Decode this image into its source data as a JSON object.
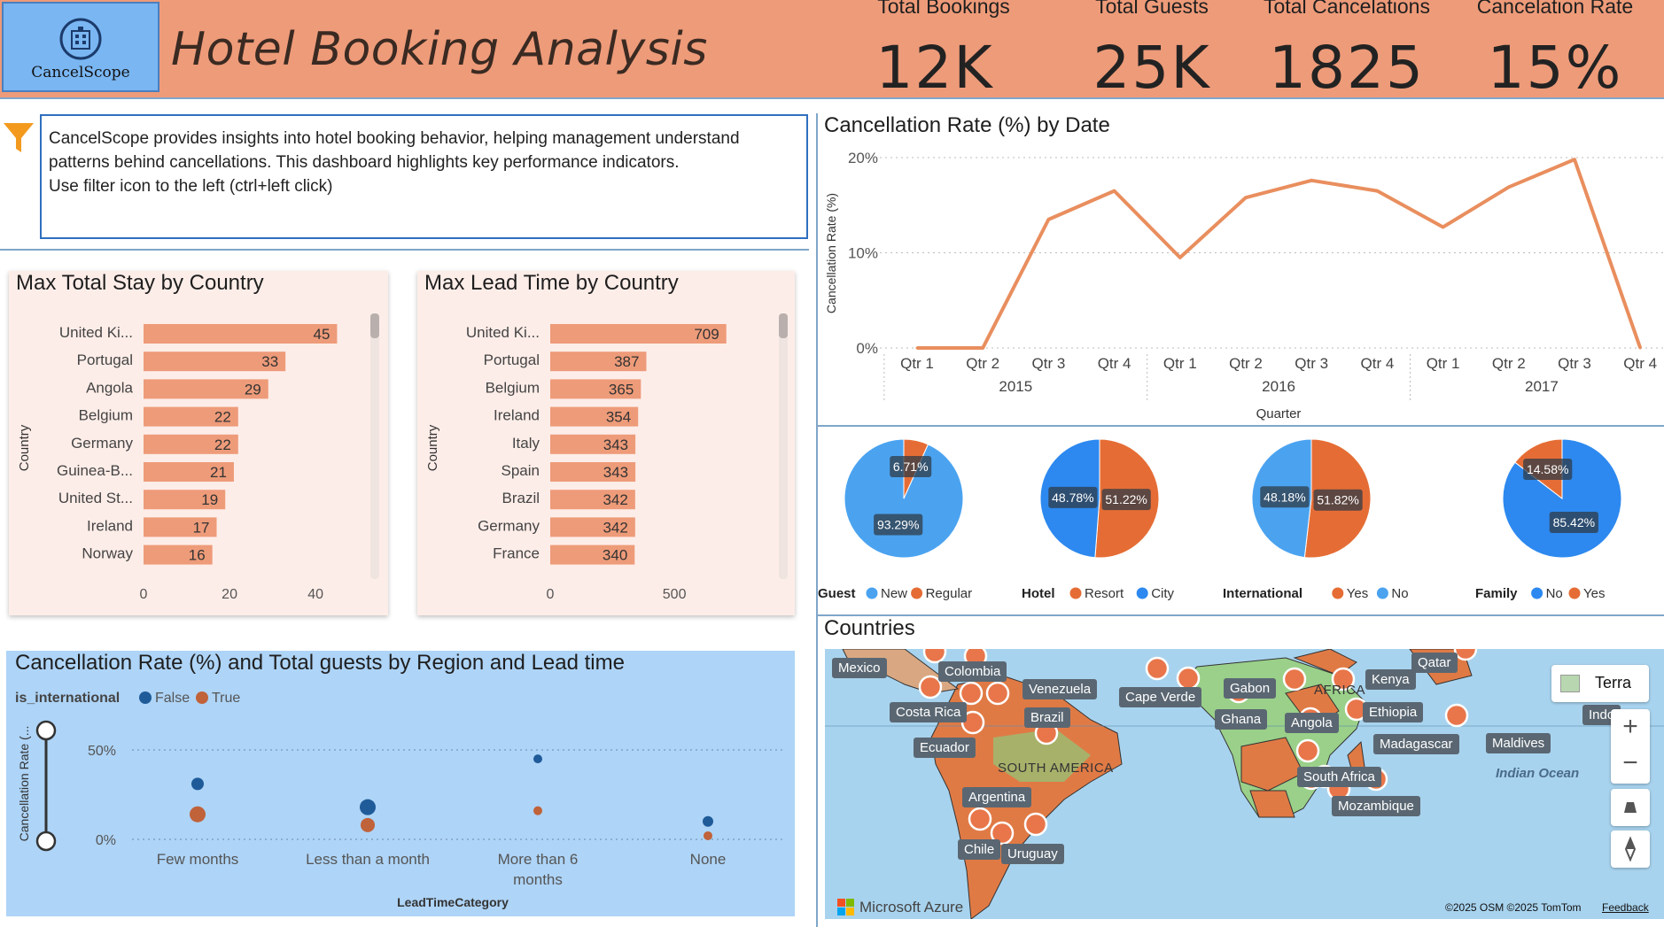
{
  "header": {
    "logo_text": "CancelScope",
    "title": "Hotel Booking Analysis",
    "kpis": [
      {
        "label": "Total Bookings",
        "value": "12K"
      },
      {
        "label": "Total Guests",
        "value": "25K"
      },
      {
        "label": "Total Cancelations",
        "value": "1825"
      },
      {
        "label": "Cancelation Rate",
        "value": "15%"
      }
    ]
  },
  "description": {
    "line1": "CancelScope provides insights into hotel booking behavior, helping management understand",
    "line2": "patterns behind cancellations. This dashboard highlights key performance indicators.",
    "line3": "Use filter icon to the left (ctrl+left click)"
  },
  "colors": {
    "header_bg": "#EE9B79",
    "bar": "#EE9B79",
    "orange": "#E56D35",
    "blue": "#2D89EF",
    "light_blue": "#4BA3F0",
    "panel_bg": "#FDEDE8",
    "scatter_bg": "#AED4F7",
    "navy": "#1F5B99"
  },
  "chart_data": [
    {
      "type": "bar",
      "title": "Max Total Stay by Country",
      "ylabel": "Country",
      "categories": [
        "United Ki...",
        "Portugal",
        "Angola",
        "Belgium",
        "Germany",
        "Guinea-B...",
        "United St...",
        "Ireland",
        "Norway"
      ],
      "values": [
        45,
        33,
        29,
        22,
        22,
        21,
        19,
        17,
        16
      ],
      "xticks": [
        "0",
        "20",
        "40"
      ],
      "xlim": [
        0,
        48
      ]
    },
    {
      "type": "bar",
      "title": "Max Lead Time by Country",
      "ylabel": "Country",
      "categories": [
        "United Ki...",
        "Portugal",
        "Belgium",
        "Ireland",
        "Italy",
        "Spain",
        "Brazil",
        "Germany",
        "France"
      ],
      "values": [
        709,
        387,
        365,
        354,
        343,
        343,
        342,
        342,
        340
      ],
      "xticks": [
        "0",
        "500"
      ],
      "xlim": [
        0,
        760
      ]
    },
    {
      "type": "line",
      "title": "Cancellation Rate (%) by Date",
      "xlabel": "Quarter",
      "ylabel": "Cancellation Rate (%)",
      "x": [
        "Qtr 1",
        "Qtr 2",
        "Qtr 3",
        "Qtr 4",
        "Qtr 1",
        "Qtr 2",
        "Qtr 3",
        "Qtr 4",
        "Qtr 1",
        "Qtr 2",
        "Qtr 3",
        "Qtr 4"
      ],
      "years": [
        "2015",
        "2016",
        "2017"
      ],
      "values": [
        0,
        0,
        13.5,
        16.5,
        9.5,
        15.8,
        17.6,
        16.5,
        12.7,
        16.9,
        19.8,
        0
      ],
      "yticks": [
        "0%",
        "10%",
        "20%"
      ],
      "ylim": [
        0,
        20
      ]
    },
    {
      "type": "pie",
      "legend_title": "Guest",
      "labels": [
        "New",
        "Regular"
      ],
      "values": [
        93.29,
        6.71
      ],
      "value_labels": [
        "93.29%",
        "6.71%"
      ]
    },
    {
      "type": "pie",
      "legend_title": "Hotel",
      "labels": [
        "Resort",
        "City"
      ],
      "values": [
        51.22,
        48.78
      ],
      "value_labels": [
        "51.22%",
        "48.78%"
      ]
    },
    {
      "type": "pie",
      "legend_title": "International",
      "labels": [
        "Yes",
        "No"
      ],
      "values": [
        51.82,
        48.18
      ],
      "value_labels": [
        "51.82%",
        "48.18%"
      ]
    },
    {
      "type": "pie",
      "legend_title": "Family",
      "labels": [
        "No",
        "Yes"
      ],
      "values": [
        85.42,
        14.58
      ],
      "value_labels": [
        "85.42%",
        "14.58%"
      ]
    },
    {
      "type": "scatter",
      "title": "Cancellation Rate (%) and Total guests by Region and Lead time",
      "legend_title": "is_international",
      "xlabel": "LeadTimeCategory",
      "ylabel": "Cancellation Rate (...",
      "categories": [
        "Few months",
        "Less than a month",
        "More than 6 months",
        "None"
      ],
      "yticks": [
        "0%",
        "50%"
      ],
      "ylim": [
        0,
        55
      ],
      "series": [
        {
          "name": "False",
          "values": [
            31,
            18,
            45,
            10
          ]
        },
        {
          "name": "True",
          "values": [
            14,
            8,
            16,
            2
          ]
        }
      ]
    }
  ],
  "map": {
    "title": "Countries",
    "style_button": "Terra",
    "attribution": "©2025 OSM  ©2025 TomTom",
    "feedback": "Feedback",
    "brand": "Microsoft Azure",
    "region_labels": [
      "SOUTH AMERICA",
      "AFRICA",
      "Indian Ocean"
    ],
    "country_labels": [
      "Mexico",
      "Colombia",
      "Venezuela",
      "Costa Rica",
      "Brazil",
      "Ecuador",
      "Argentina",
      "Chile",
      "Uruguay",
      "Cape Verde",
      "Gabon",
      "Ghana",
      "Angola",
      "Kenya",
      "Qatar",
      "Ethiopia",
      "Madagascar",
      "South Africa",
      "Mozambique",
      "Maldives",
      "Indo"
    ]
  }
}
